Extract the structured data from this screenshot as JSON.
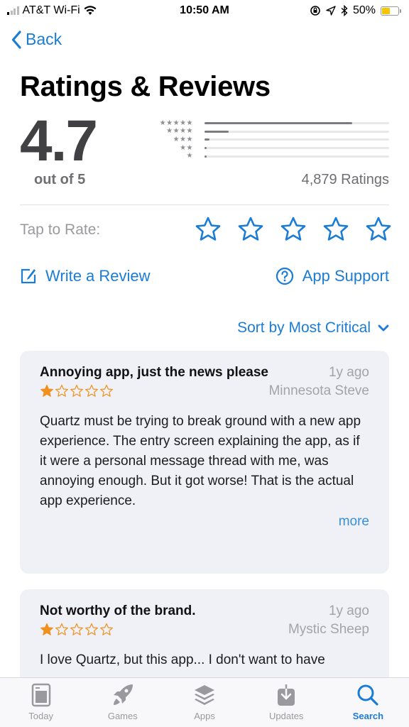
{
  "status_bar": {
    "carrier": "AT&T Wi-Fi",
    "time": "10:50 AM",
    "battery": "50%",
    "battery_level": 0.5,
    "signal_bars_filled": 1,
    "signal_bars_total": 4
  },
  "nav": {
    "back_label": "Back"
  },
  "header": {
    "title": "Ratings & Reviews"
  },
  "summary": {
    "average": "4.7",
    "out_of": "out of 5",
    "ratings_count": "4,879 Ratings",
    "histogram": [
      {
        "stars": 5,
        "label": "★★★★★",
        "fraction": 0.8
      },
      {
        "stars": 4,
        "label": "★★★★",
        "fraction": 0.13
      },
      {
        "stars": 3,
        "label": "★★★",
        "fraction": 0.025
      },
      {
        "stars": 2,
        "label": "★★",
        "fraction": 0.005
      },
      {
        "stars": 1,
        "label": "★",
        "fraction": 0.012
      }
    ]
  },
  "tap_to_rate": {
    "label": "Tap to Rate:",
    "stars": 5
  },
  "actions": {
    "write_review": "Write a Review",
    "app_support": "App Support"
  },
  "sort": {
    "label": "Sort by Most Critical"
  },
  "reviews": [
    {
      "title": "Annoying app, just the news please",
      "date": "1y ago",
      "author": "Minnesota Steve",
      "rating": 1,
      "body": "Quartz must be trying to break ground with a new app experience.  The entry screen explaining the app, as if it were a personal message thread with me, was annoying enough.  But it got worse!  That is the actual app experience.",
      "more_label": "more"
    },
    {
      "title": "Not worthy of the brand.",
      "date": "1y ago",
      "author": "Mystic Sheep",
      "rating": 1,
      "body": "I love Quartz, but this app... I don't want to have"
    }
  ],
  "tab_bar": {
    "tabs": [
      {
        "label": "Today",
        "icon": "today-icon",
        "active": false
      },
      {
        "label": "Games",
        "icon": "rocket-icon",
        "active": false
      },
      {
        "label": "Apps",
        "icon": "stack-icon",
        "active": false
      },
      {
        "label": "Updates",
        "icon": "download-icon",
        "active": false
      },
      {
        "label": "Search",
        "icon": "search-icon",
        "active": true
      }
    ]
  },
  "colors": {
    "accent": "#1b7cd6",
    "star_orange": "#f0901e",
    "card_bg": "#f0f0f7",
    "secondary_text": "#a3a3a8"
  }
}
